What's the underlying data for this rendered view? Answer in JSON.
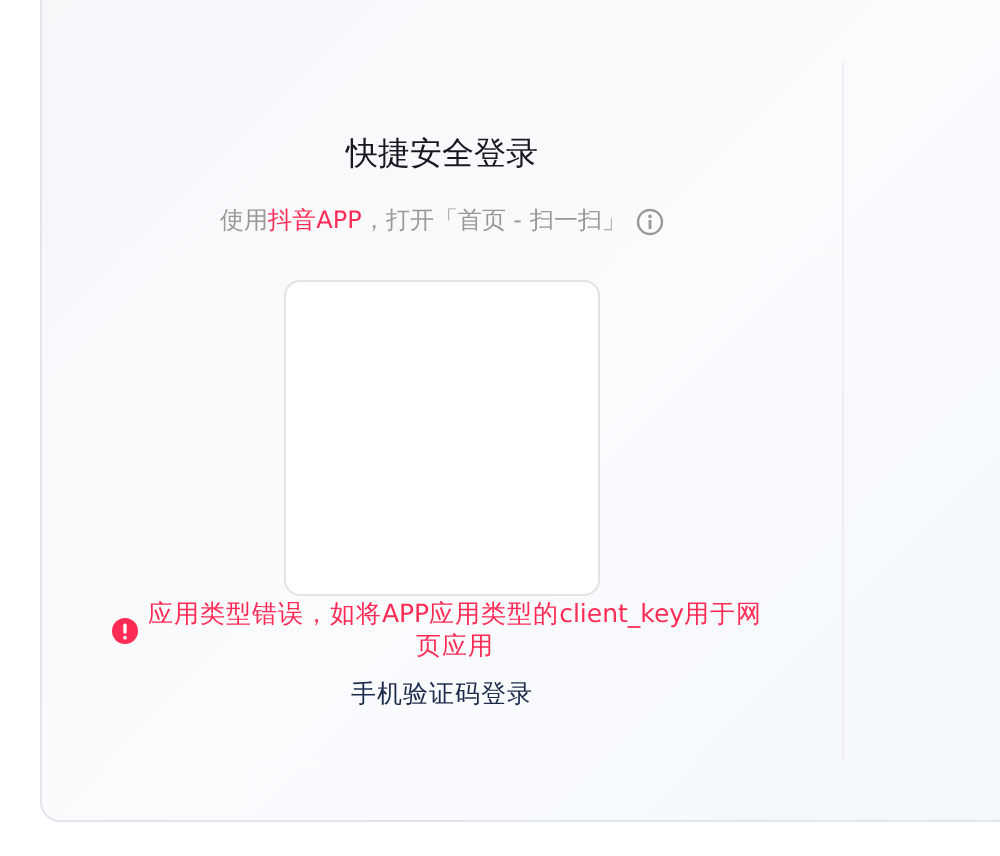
{
  "login": {
    "title": "快捷安全登录",
    "subtitle": {
      "before": "使用 ",
      "app": "抖音APP",
      "after": "，打开「首页 - 扫一扫」"
    },
    "error": "应用类型错误，如将APP应用类型的client_key用于网页应用",
    "sms_link": "手机验证码登录"
  }
}
